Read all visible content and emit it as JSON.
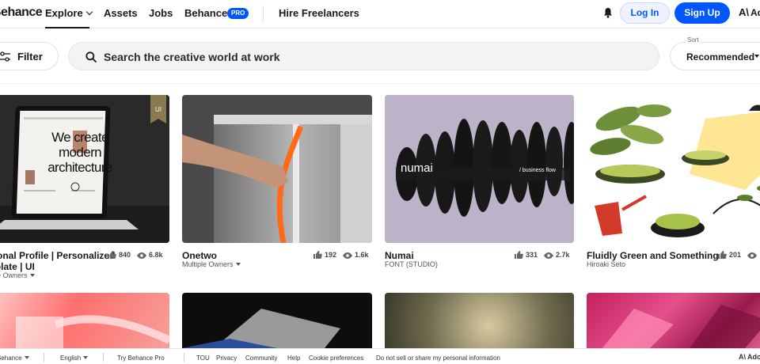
{
  "header": {
    "logo": "Behance",
    "nav": {
      "explore": "Explore",
      "assets": "Assets",
      "jobs": "Jobs",
      "behance": "Behance",
      "pro_badge": "PRO",
      "hire": "Hire Freelancers"
    },
    "login": "Log In",
    "signup": "Sign Up",
    "adobe": "Adobe"
  },
  "search": {
    "filter_label": "Filter",
    "placeholder": "Search the creative world at work",
    "sort_caption": "Sort",
    "sort_value": "Recommended"
  },
  "projects": [
    {
      "title_line1": "Personal Profile | Personalized",
      "title_line2": "Template | UI",
      "owner": "Multiple Owners",
      "likes": "840",
      "views": "6.8k",
      "badge": "UI",
      "hero_text": "We create modern architecture"
    },
    {
      "title_line1": "Onetwo",
      "owner": "Multiple Owners",
      "likes": "192",
      "views": "1.6k"
    },
    {
      "title_line1": "Numai",
      "owner": "FONT (STUDIO)",
      "likes": "331",
      "views": "2.7k",
      "art_word": "numai",
      "art_tag": "/ business flow"
    },
    {
      "title_line1": "Fluidly Green and Something",
      "owner": "Hiroaki Seto",
      "likes": "201",
      "views": ""
    }
  ],
  "footer": {
    "behance": "Behance",
    "english": "English",
    "try_pro": "Try Behance Pro",
    "tou": "TOU",
    "privacy": "Privacy",
    "community": "Community",
    "help": "Help",
    "cookie": "Cookie preferences",
    "do_not_sell": "Do not sell or share my personal information",
    "adobe": "Adobe"
  },
  "colors": {
    "accent": "#0057ff",
    "text": "#191919"
  }
}
